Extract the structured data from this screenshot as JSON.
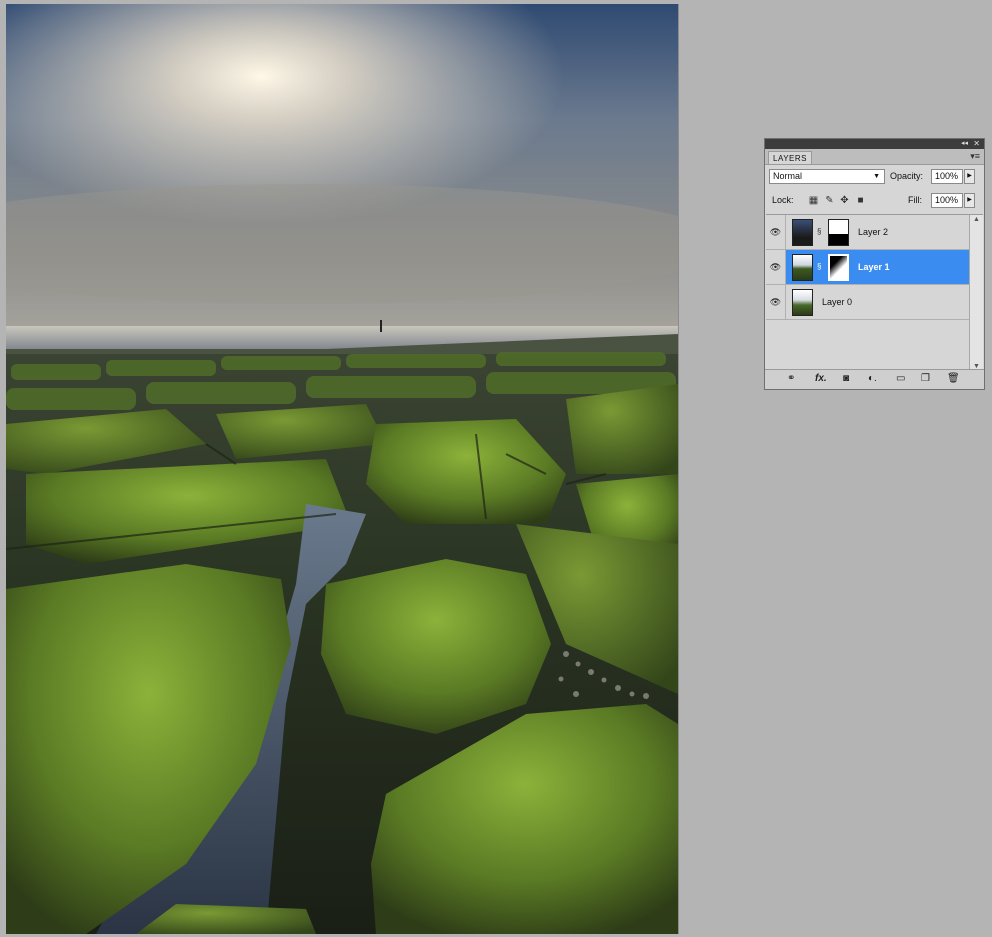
{
  "panel": {
    "tab_label": "LAYERS",
    "collapse_glyph": "◂◂",
    "close_glyph": "✕",
    "menu_glyph": "▾≡",
    "blend_mode": "Normal",
    "opacity_label": "Opacity:",
    "opacity_value": "100%",
    "lock_label": "Lock:",
    "fill_label": "Fill:",
    "fill_value": "100%",
    "layers": [
      {
        "name": "Layer 2",
        "selected": false,
        "has_mask": true
      },
      {
        "name": "Layer 1",
        "selected": true,
        "has_mask": true
      },
      {
        "name": "Layer 0",
        "selected": false,
        "has_mask": false
      }
    ],
    "bottom_icons": [
      "link-layers-icon",
      "fx-icon",
      "add-mask-icon",
      "adjustment-layer-icon",
      "new-group-icon",
      "new-layer-icon",
      "trash-icon"
    ],
    "selection_color": "#3a8cf0"
  }
}
